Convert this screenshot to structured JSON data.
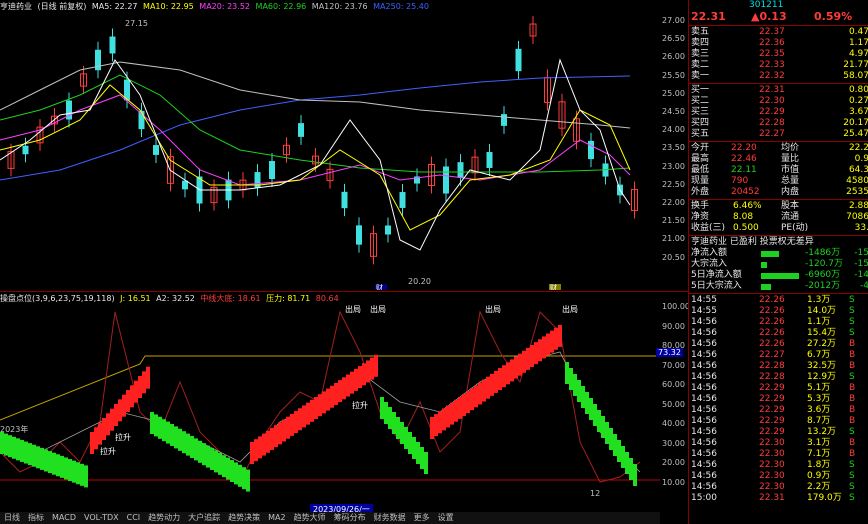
{
  "main_legend": {
    "name": "亨迪药业",
    "mode": "(日线 前复权)",
    "ma5": "MA5: 22.27",
    "ma10": "MA10: 22.95",
    "ma20": "MA20: 23.52",
    "ma60": "MA60: 22.96",
    "ma120": "MA120: 23.76",
    "ma250": "MA250: 25.40",
    "colors": {
      "ma5": "#ffffff",
      "ma10": "#ffff00",
      "ma20": "#ff40ff",
      "ma60": "#20d020",
      "ma120": "#c0c0c0",
      "ma250": "#4060ff"
    }
  },
  "main_axis": [
    "27.00",
    "26.50",
    "26.00",
    "25.50",
    "25.00",
    "24.50",
    "24.00",
    "23.50",
    "23.00",
    "22.50",
    "22.00",
    "21.50",
    "21.00",
    "20.50"
  ],
  "main_annotations": {
    "high": "27.15",
    "low": "20.20",
    "cai1": "财",
    "cai2": "财"
  },
  "sub_legend": {
    "name": "操盘点位(3,9,6,23,75,19,118)",
    "j": "J: 16.51",
    "a2": "A2: 32.52",
    "zhongchang": "中线大底: 18.61",
    "yali": "压力: 81.71",
    "extra": "80.64"
  },
  "sub_axis": [
    "100.00",
    "90.00",
    "80.00",
    "70.00",
    "60.00",
    "50.00",
    "40.00",
    "30.00",
    "20.00",
    "10.00"
  ],
  "sub_marker": "73.32",
  "sub_labels": {
    "out1": "出局",
    "out2": "出局",
    "out3": "出局",
    "out4": "出局",
    "up1": "拉升",
    "up2": "拉升",
    "up3": "拉升"
  },
  "date_labels": {
    "left": "2023年",
    "mid": "2023/09/26/一",
    "right_num": "12"
  },
  "tabs": [
    "日线",
    "指标",
    "MACD",
    "VOL-TDX",
    "CCI",
    "趋势动力",
    "大户追踪",
    "趋势决策",
    "MA2",
    "趋势大师",
    "筹码分布",
    "财务数据",
    "更多",
    "设置"
  ],
  "quote": {
    "code": "301211",
    "price": "22.31",
    "change": "▲0.13",
    "pct": "0.59%",
    "asks": [
      {
        "label": "卖五",
        "price": "22.37",
        "vol": "0.47"
      },
      {
        "label": "卖四",
        "price": "22.36",
        "vol": "1.17"
      },
      {
        "label": "卖三",
        "price": "22.35",
        "vol": "4.97"
      },
      {
        "label": "卖二",
        "price": "22.33",
        "vol": "21.77"
      },
      {
        "label": "卖一",
        "price": "22.32",
        "vol": "58.07"
      }
    ],
    "bids": [
      {
        "label": "买一",
        "price": "22.31",
        "vol": "0.80"
      },
      {
        "label": "买二",
        "price": "22.30",
        "vol": "0.27"
      },
      {
        "label": "买三",
        "price": "22.29",
        "vol": "3.67"
      },
      {
        "label": "买四",
        "price": "22.28",
        "vol": "20.17"
      },
      {
        "label": "买五",
        "price": "22.27",
        "vol": "25.47"
      }
    ],
    "stats": [
      {
        "l1": "今开",
        "v1": "22.20",
        "l2": "均价",
        "v2": "22.2"
      },
      {
        "l1": "最高",
        "v1": "22.46",
        "l2": "量比",
        "v2": "0.9"
      },
      {
        "l1": "最低",
        "v1": "22.11",
        "l2": "市值",
        "v2": "64.3"
      },
      {
        "l1": "现量",
        "v1": "790",
        "l2": "总量",
        "v2": "4580"
      },
      {
        "l1": "外盘",
        "v1": "20452",
        "l2": "内盘",
        "v2": "2535"
      }
    ],
    "stats2": [
      {
        "l1": "换手",
        "v1": "6.46%",
        "l2": "股本",
        "v2": "2.88"
      },
      {
        "l1": "净资",
        "v1": "8.08",
        "l2": "流通",
        "v2": "7086"
      },
      {
        "l1": "收益(三)",
        "v1": "0.500",
        "l2": "PE(动)",
        "v2": "33."
      }
    ],
    "status": "亨迪药业 已盈利 投票权无差异",
    "flows": [
      {
        "label": "净流入额",
        "value": "-1486万",
        "pct": "-15"
      },
      {
        "label": "大宗流入",
        "value": "-120.7万",
        "pct": "-15"
      },
      {
        "label": "5日净流入额",
        "value": "-6960万",
        "pct": "-14"
      },
      {
        "label": "5日大宗流入",
        "value": "-2012万",
        "pct": "-4"
      }
    ],
    "ticks": [
      {
        "t": "14:55",
        "p": "22.26",
        "v": "1.3万",
        "s": "S"
      },
      {
        "t": "14:55",
        "p": "22.26",
        "v": "14.0万",
        "s": "S"
      },
      {
        "t": "14:56",
        "p": "22.26",
        "v": "1.1万",
        "s": "S"
      },
      {
        "t": "14:56",
        "p": "22.26",
        "v": "15.4万",
        "s": "S"
      },
      {
        "t": "14:56",
        "p": "22.26",
        "v": "27.2万",
        "s": "B"
      },
      {
        "t": "14:56",
        "p": "22.27",
        "v": "6.7万",
        "s": "B"
      },
      {
        "t": "14:56",
        "p": "22.28",
        "v": "32.5万",
        "s": "B"
      },
      {
        "t": "14:56",
        "p": "22.28",
        "v": "12.9万",
        "s": "S"
      },
      {
        "t": "14:56",
        "p": "22.29",
        "v": "5.1万",
        "s": "B"
      },
      {
        "t": "14:56",
        "p": "22.29",
        "v": "5.3万",
        "s": "B"
      },
      {
        "t": "14:56",
        "p": "22.29",
        "v": "3.6万",
        "s": "B"
      },
      {
        "t": "14:56",
        "p": "22.29",
        "v": "8.7万",
        "s": "B"
      },
      {
        "t": "14:56",
        "p": "22.29",
        "v": "13.2万",
        "s": "S"
      },
      {
        "t": "14:56",
        "p": "22.30",
        "v": "3.1万",
        "s": "B"
      },
      {
        "t": "14:56",
        "p": "22.30",
        "v": "7.1万",
        "s": "B"
      },
      {
        "t": "14:56",
        "p": "22.30",
        "v": "1.8万",
        "s": "S"
      },
      {
        "t": "14:56",
        "p": "22.30",
        "v": "0.9万",
        "s": "S"
      },
      {
        "t": "14:56",
        "p": "22.30",
        "v": "2.2万",
        "s": "S"
      },
      {
        "t": "15:00",
        "p": "22.31",
        "v": "179.0万",
        "s": "S"
      }
    ]
  }
}
